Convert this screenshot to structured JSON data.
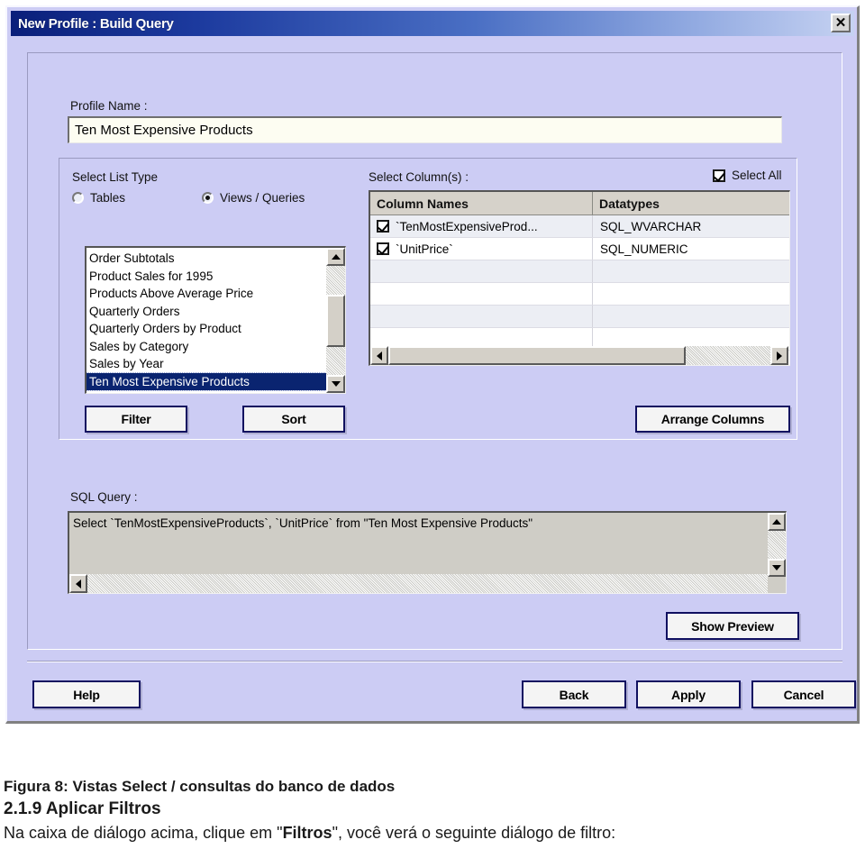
{
  "window": {
    "title": "New Profile : Build Query",
    "close_label": "✕"
  },
  "profile": {
    "label": "Profile Name :",
    "value": "Ten Most Expensive Products",
    "placeholder": ""
  },
  "list_type": {
    "label": "Select List Type",
    "options": [
      {
        "label": "Tables",
        "selected": false
      },
      {
        "label": "Views / Queries",
        "selected": true
      }
    ]
  },
  "object_list": {
    "items": [
      {
        "label": "Order Subtotals",
        "selected": false
      },
      {
        "label": "Product Sales for 1995",
        "selected": false
      },
      {
        "label": "Products Above Average Price",
        "selected": false
      },
      {
        "label": "Quarterly Orders",
        "selected": false
      },
      {
        "label": "Quarterly Orders by Product",
        "selected": false
      },
      {
        "label": "Sales by Category",
        "selected": false
      },
      {
        "label": "Sales by Year",
        "selected": false
      },
      {
        "label": "Ten Most Expensive Products",
        "selected": true
      }
    ]
  },
  "columns_panel": {
    "label": "Select Column(s) :",
    "select_all_label": "Select All",
    "select_all_checked": true,
    "headers": [
      "Column Names",
      "Datatypes"
    ],
    "rows": [
      {
        "checked": true,
        "name": "`TenMostExpensiveProd...",
        "datatype": "SQL_WVARCHAR"
      },
      {
        "checked": true,
        "name": "`UnitPrice`",
        "datatype": "SQL_NUMERIC"
      },
      {
        "checked": null,
        "name": "",
        "datatype": ""
      },
      {
        "checked": null,
        "name": "",
        "datatype": ""
      },
      {
        "checked": null,
        "name": "",
        "datatype": ""
      },
      {
        "checked": null,
        "name": "",
        "datatype": ""
      }
    ]
  },
  "group_buttons": {
    "filter": "Filter",
    "sort": "Sort",
    "arrange_columns": "Arrange Columns"
  },
  "sql": {
    "label": "SQL Query :",
    "text": "Select `TenMostExpensiveProducts`, `UnitPrice` from \"Ten Most Expensive Products\"",
    "show_preview": "Show Preview"
  },
  "footer": {
    "help": "Help",
    "back": "Back",
    "apply": "Apply",
    "cancel": "Cancel"
  },
  "caption": {
    "figure": "Figura 8: Vistas Select / consultas do banco de dados",
    "section": "2.1.9 Aplicar Filtros",
    "body_before": "Na caixa de diálogo acima, clique em \"",
    "body_bold": "Filtros",
    "body_after": "\", você verá o seguinte diálogo de filtro:"
  },
  "colors": {
    "window_face": "#ccccf4",
    "title_start": "#0a1f7a",
    "title_end": "#c6d2f2",
    "selection": "#0a2470",
    "button_border": "#101060"
  }
}
